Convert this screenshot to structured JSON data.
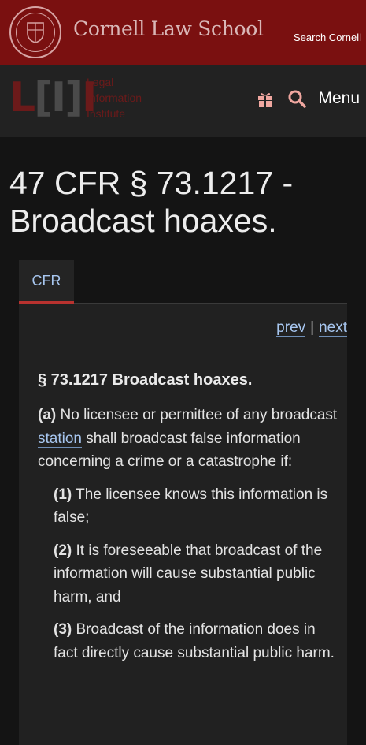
{
  "header": {
    "school_name": "Cornell Law School",
    "search_cornell": "Search Cornell",
    "lii_mark": "LII",
    "lii_words": [
      "Legal",
      "Information",
      "Institute"
    ],
    "menu_label": "Menu",
    "icons": [
      "cornell-seal-icon",
      "gift-icon",
      "search-icon"
    ],
    "colors": {
      "cornell_red": "#7a1010",
      "link": "#a7c6ef",
      "tab_accent": "#b8322f"
    }
  },
  "page": {
    "title": "47 CFR § 73.1217 - Broadcast hoaxes."
  },
  "tabs": [
    {
      "label": "CFR",
      "active": true
    }
  ],
  "nav": {
    "prev": "prev",
    "separator": "|",
    "next": "next"
  },
  "content": {
    "section_heading": "§ 73.1217 Broadcast hoaxes.",
    "para_a": {
      "label": "(a)",
      "text_before": " No licensee or permittee of any broadcast ",
      "link": "station",
      "text_after": " shall broadcast false information concerning a crime or a catastrophe if:"
    },
    "items": [
      {
        "label": "(1)",
        "text": " The licensee knows this information is false;"
      },
      {
        "label": "(2)",
        "text": " It is foreseeable that broadcast of the information will cause substantial public harm, and"
      },
      {
        "label": "(3)",
        "text": " Broadcast of the information does in fact directly cause substantial public harm."
      }
    ]
  }
}
